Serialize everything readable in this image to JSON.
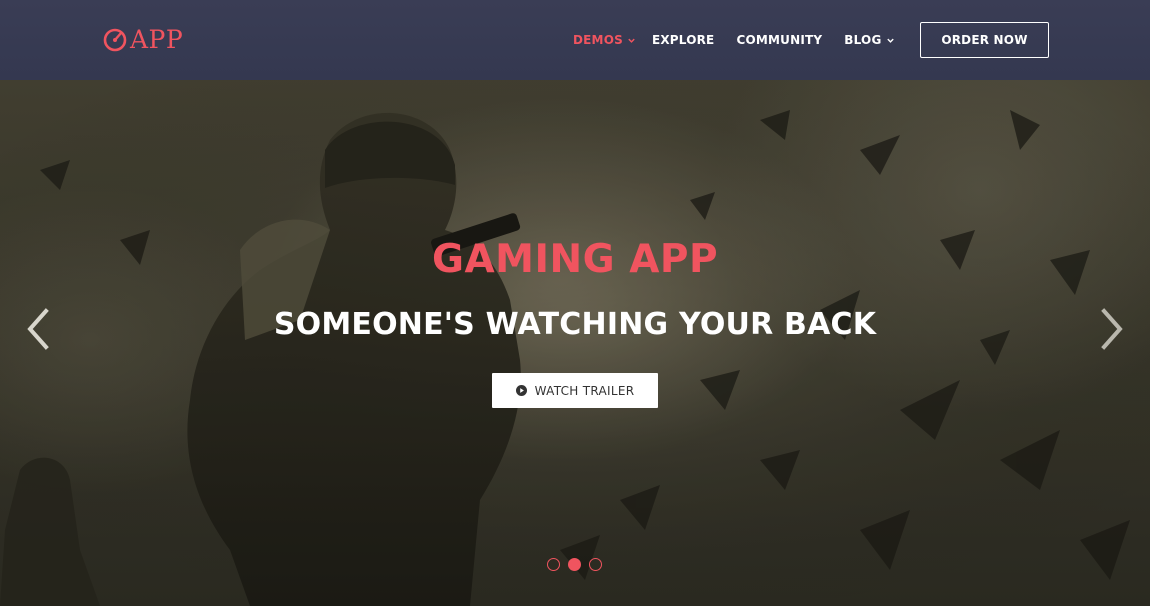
{
  "brand": {
    "logo_text": "APP",
    "accent": "#f0545f",
    "header_bg": "#363a52"
  },
  "nav": {
    "items": [
      {
        "label": "DEMOS",
        "active": true,
        "dropdown": true
      },
      {
        "label": "EXPLORE",
        "active": false,
        "dropdown": false
      },
      {
        "label": "COMMUNITY",
        "active": false,
        "dropdown": false
      },
      {
        "label": "BLOG",
        "active": false,
        "dropdown": true
      }
    ],
    "cta_label": "ORDER NOW"
  },
  "hero": {
    "title": "GAMING APP",
    "subtitle": "SOMEONE'S WATCHING YOUR BACK",
    "button_label": "WATCH TRAILER",
    "button_icon": "play-circle-icon",
    "prev_icon": "chevron-left-icon",
    "next_icon": "chevron-right-icon",
    "slides_total": 3,
    "slide_active": 2
  }
}
